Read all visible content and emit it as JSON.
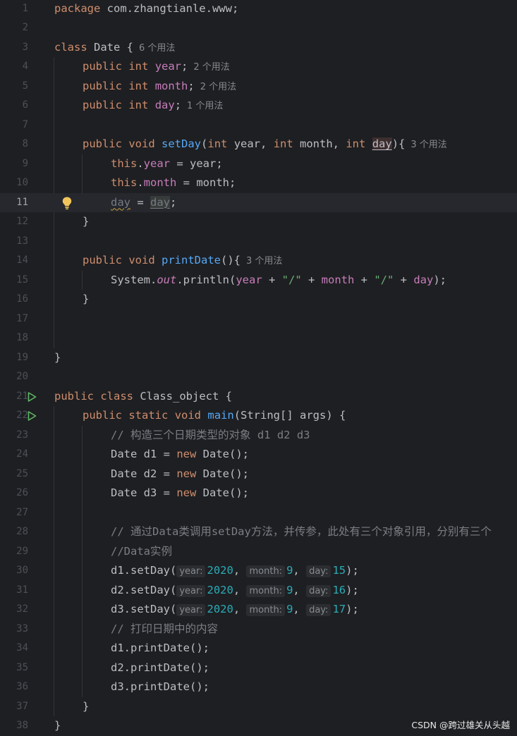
{
  "editor": {
    "current_line": 11,
    "line_numbers": [
      "1",
      "2",
      "3",
      "4",
      "5",
      "6",
      "7",
      "8",
      "9",
      "10",
      "11",
      "12",
      "13",
      "14",
      "15",
      "16",
      "17",
      "18",
      "19",
      "20",
      "21",
      "22",
      "23",
      "24",
      "25",
      "26",
      "27",
      "28",
      "29",
      "30",
      "31",
      "32",
      "33",
      "34",
      "35",
      "36",
      "37",
      "38"
    ],
    "usages": {
      "date_class": "6 个用法",
      "year_field": "2 个用法",
      "month_field": "2 个用法",
      "day_field": "1 个用法",
      "set_day": "3 个用法",
      "print_date": "3 个用法"
    },
    "comments": {
      "create_objects": "// 构造三个日期类型的对象 d1 d2 d3",
      "call_set_day": "// 通过Data类调用setDay方法，并传参，此处有三个对象引用，分别有三个",
      "data_instance": "//Data实例",
      "print_content": "// 打印日期中的内容"
    },
    "hints": {
      "year": "year:",
      "month": "month:",
      "day": "day:"
    },
    "calls": [
      {
        "obj": "d1",
        "year": "2020",
        "month": "9",
        "day": "15"
      },
      {
        "obj": "d2",
        "year": "2020",
        "month": "9",
        "day": "16"
      },
      {
        "obj": "d3",
        "year": "2020",
        "month": "9",
        "day": "17"
      }
    ],
    "icons": [
      "run-gutter-icon",
      "run-gutter-icon",
      "lightbulb-icon"
    ],
    "colors": {
      "background": "#1e1f22",
      "keyword": "#cf8e6d",
      "field": "#c77dbb",
      "function": "#56a8f5",
      "string": "#6aab73",
      "number": "#2aacb8",
      "comment": "#7a7e85"
    }
  },
  "watermark": "CSDN @跨过雄关从头越"
}
